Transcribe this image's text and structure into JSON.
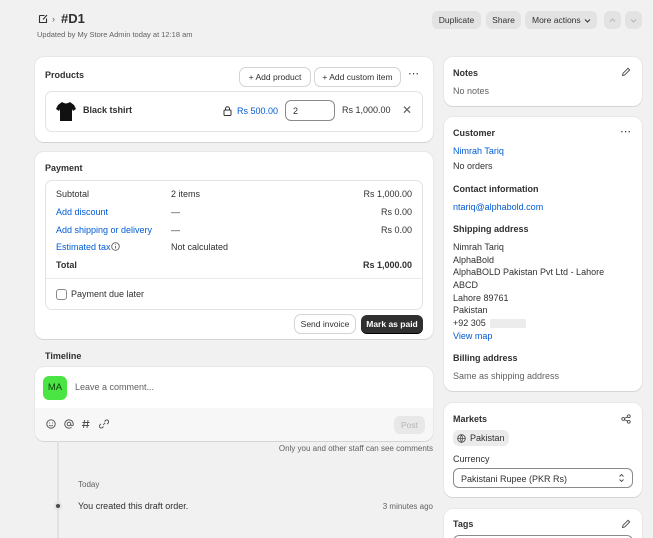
{
  "header": {
    "order_id": "#D1",
    "subtitle": "Updated by My Store Admin today at 12:18 am",
    "duplicate_label": "Duplicate",
    "share_label": "Share",
    "more_actions_label": "More actions"
  },
  "products": {
    "title": "Products",
    "add_product_label": "Add product",
    "add_custom_item_label": "Add custom item",
    "item": {
      "name": "Black tshirt",
      "price": "Rs 500.00",
      "quantity": "2",
      "total": "Rs 1,000.00"
    }
  },
  "payment": {
    "title": "Payment",
    "rows": [
      {
        "label": "Subtotal",
        "middle": "2 items",
        "value": "Rs 1,000.00"
      },
      {
        "label": "Add discount",
        "middle": "—",
        "value": "Rs 0.00"
      },
      {
        "label": "Add shipping or delivery",
        "middle": "—",
        "value": "Rs 0.00"
      },
      {
        "label": "Estimated tax",
        "middle": "Not calculated",
        "value": ""
      },
      {
        "label": "Total",
        "middle": "",
        "value": "Rs 1,000.00"
      }
    ],
    "payment_due_later_label": "Payment due later",
    "send_invoice_label": "Send invoice",
    "mark_as_paid_label": "Mark as paid"
  },
  "timeline": {
    "title": "Timeline",
    "avatar_initials": "MA",
    "comment_placeholder": "Leave a comment...",
    "post_label": "Post",
    "visibility_note": "Only you and other staff can see comments",
    "day_label": "Today",
    "event_text": "You created this draft order.",
    "event_time": "3 minutes ago"
  },
  "notes": {
    "title": "Notes",
    "text": "No notes"
  },
  "customer": {
    "title": "Customer",
    "name": "Nimrah Tariq",
    "orders": "No orders",
    "contact_title": "Contact information",
    "email": "ntariq@alphabold.com",
    "shipping_title": "Shipping address",
    "shipping_lines": [
      "Nimrah Tariq",
      "AlphaBold",
      "AlphaBOLD Pakistan Pvt Ltd - Lahore",
      "ABCD",
      "Lahore 89761",
      "Pakistan",
      "+92 305"
    ],
    "view_map_label": "View map",
    "billing_title": "Billing address",
    "billing_text": "Same as shipping address"
  },
  "markets": {
    "title": "Markets",
    "market_name": "Pakistan",
    "currency_label": "Currency",
    "currency_value": "Pakistani Rupee (PKR Rs)"
  },
  "tags": {
    "title": "Tags"
  },
  "colors": {
    "link": "#005bd3",
    "avatar_bg": "#4be543",
    "dark_button": "#303030",
    "background": "#f1f1f1"
  }
}
